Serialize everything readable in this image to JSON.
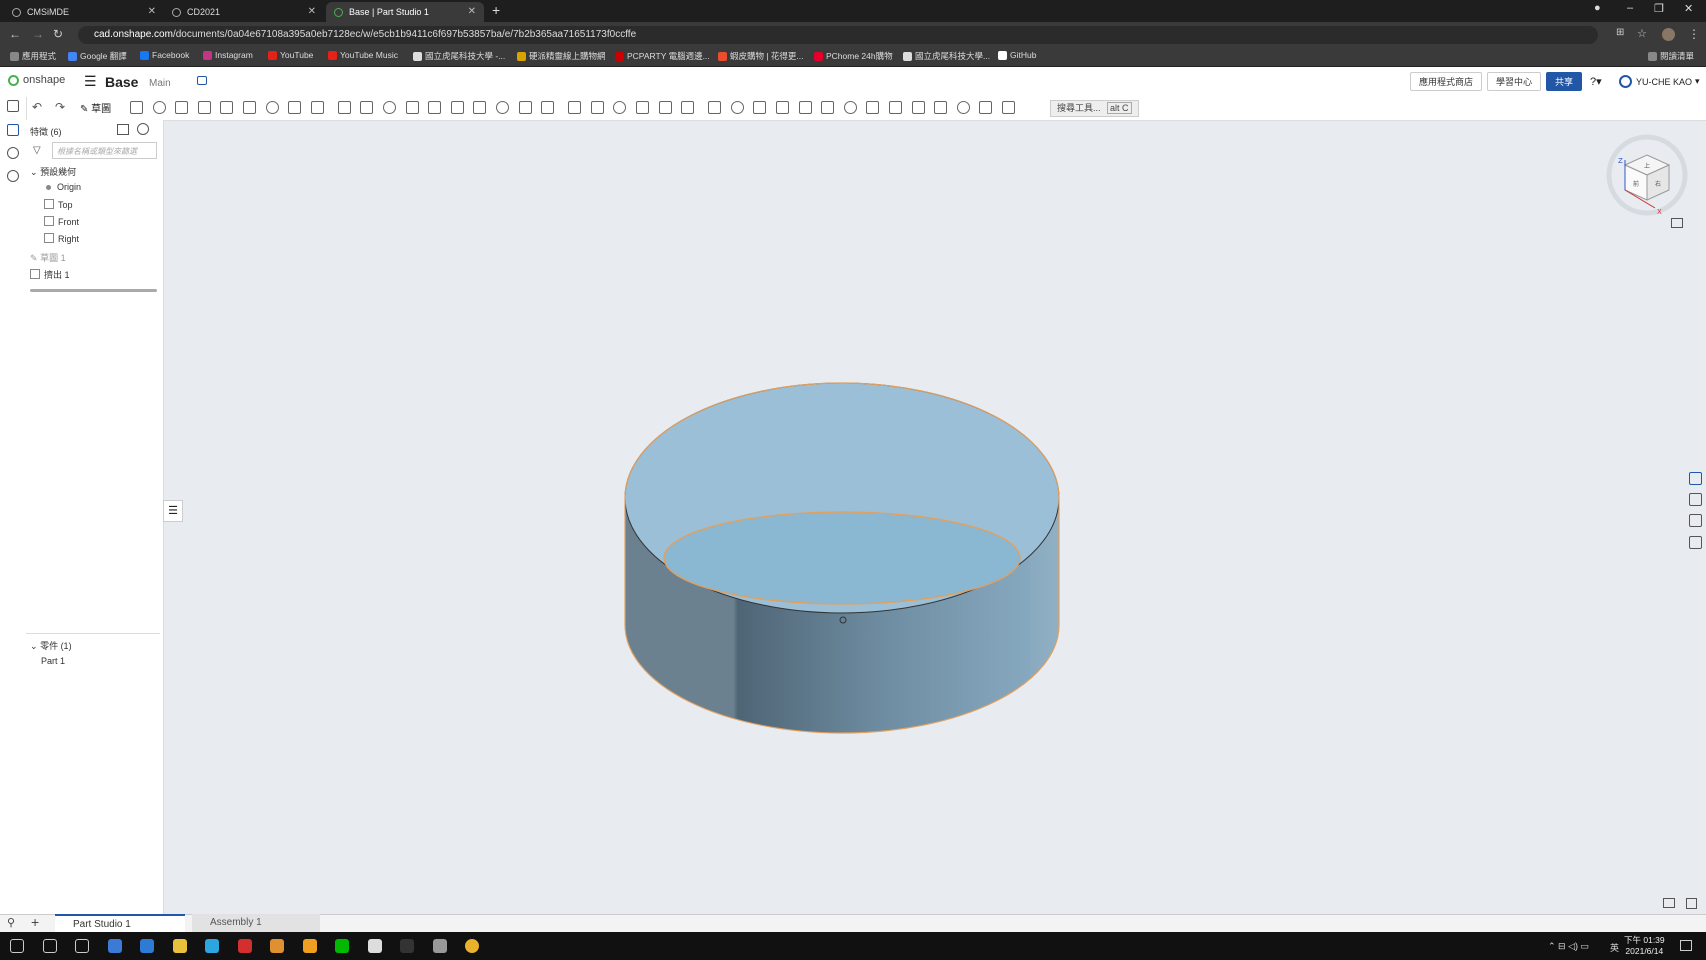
{
  "browser": {
    "tabs": [
      {
        "title": "CMSiMDE"
      },
      {
        "title": "CD2021"
      },
      {
        "title": "Base | Part Studio 1"
      }
    ],
    "url_host": "cad.onshape.com",
    "url_path": "/documents/0a04e67108a395a0eb7128ec/w/e5cb1b9411c6f697b53857ba/e/7b2b365aa71651173f0ccffe",
    "bookmarks": [
      {
        "label": "應用程式",
        "color": "#888"
      },
      {
        "label": "Google 翻譯",
        "color": "#4285f4"
      },
      {
        "label": "Facebook",
        "color": "#1877f2"
      },
      {
        "label": "Instagram",
        "color": "#c13584"
      },
      {
        "label": "YouTube",
        "color": "#e62117"
      },
      {
        "label": "YouTube Music",
        "color": "#e62117"
      },
      {
        "label": "國立虎尾科技大學 -...",
        "color": "#ddd"
      },
      {
        "label": "硬派精靈線上購物網",
        "color": "#d9a400"
      },
      {
        "label": "PCPARTY 電腦週邊...",
        "color": "#c00"
      },
      {
        "label": "蝦皮購物 | 花得更...",
        "color": "#ee4d2d"
      },
      {
        "label": "PChome 24h購物",
        "color": "#e4002b"
      },
      {
        "label": "國立虎尾科技大學...",
        "color": "#ddd"
      },
      {
        "label": "GitHub",
        "color": "#fff"
      }
    ],
    "reading_list": "閱讀清單"
  },
  "onshape": {
    "logo": "onshape",
    "doc_title": "Base",
    "branch": "Main",
    "app_store": "應用程式商店",
    "learning_center": "學習中心",
    "share": "共享",
    "user": "YU-CHE KAO",
    "search_tools": "搜尋工具...",
    "search_shortcut": "alt C"
  },
  "feature_panel": {
    "header": "特徵 (6)",
    "filter_placeholder": "根據名稱或類型來篩選",
    "default_geometry": "預設幾何",
    "origin": "Origin",
    "planes": [
      "Top",
      "Front",
      "Right"
    ],
    "sketch": "草圖 1",
    "extrude": "擠出 1",
    "parts_header": "零件 (1)",
    "part": "Part 1"
  },
  "bottom_tabs": {
    "part_studio": "Part Studio 1",
    "assembly": "Assembly 1"
  },
  "taskbar": {
    "time": "下午 01:39",
    "date": "2021/6/14",
    "ime": "英"
  },
  "viewcube": {
    "top_label": "上",
    "front_label": "前",
    "right_label": "右",
    "z": "Z",
    "x": "X"
  }
}
